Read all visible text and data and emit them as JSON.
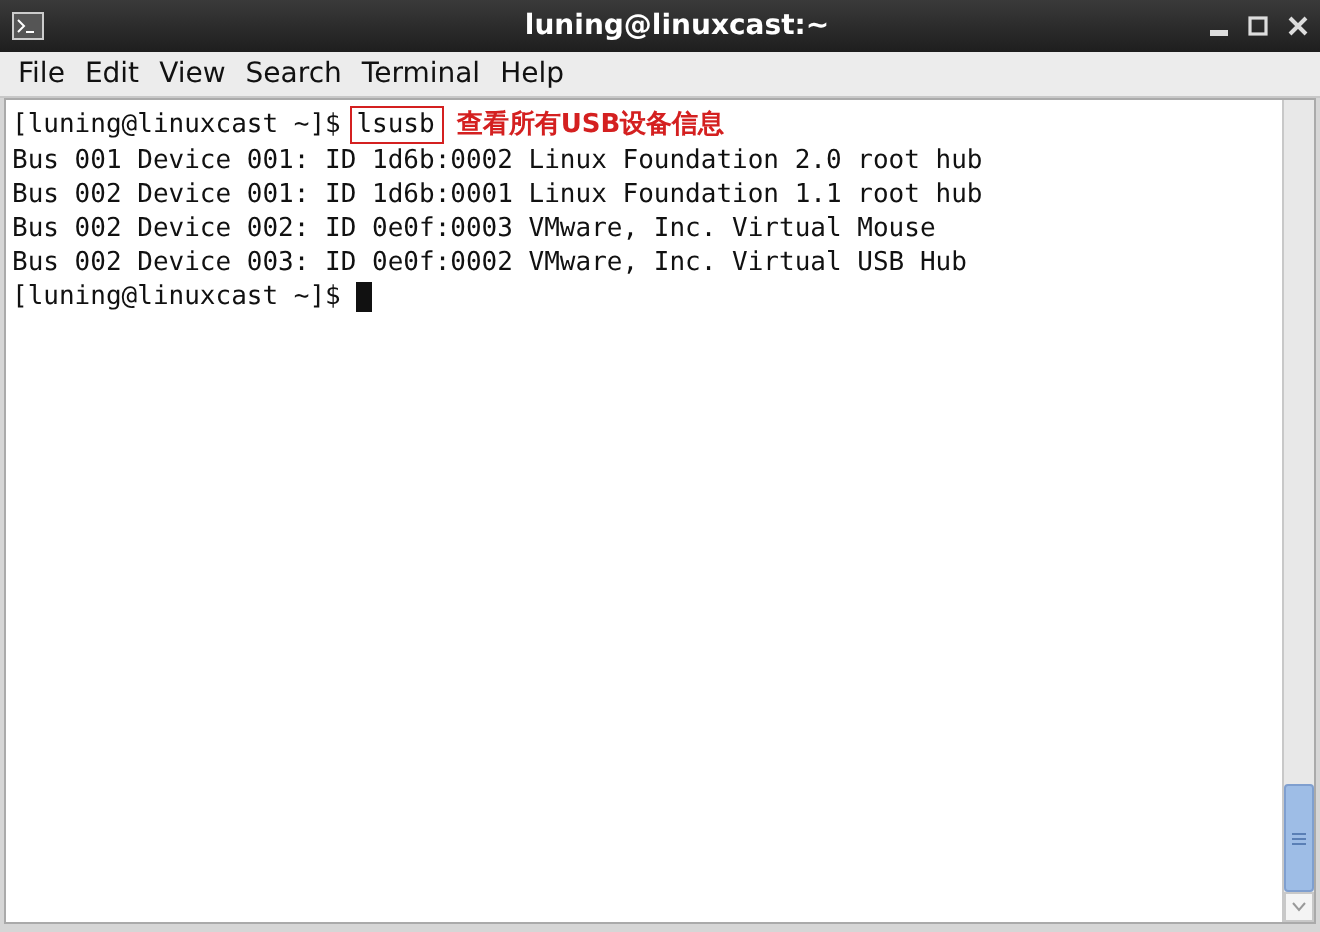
{
  "window": {
    "title": "luning@linuxcast:~"
  },
  "menu": [
    "File",
    "Edit",
    "View",
    "Search",
    "Terminal",
    "Help"
  ],
  "terminal": {
    "lines": [
      {
        "kind": "command",
        "prompt": "[luning@linuxcast ~]$ ",
        "command": "lsusb",
        "annotation": "查看所有USB设备信息"
      },
      {
        "kind": "output",
        "text": "Bus 001 Device 001: ID 1d6b:0002 Linux Foundation 2.0 root hub"
      },
      {
        "kind": "output",
        "text": "Bus 002 Device 001: ID 1d6b:0001 Linux Foundation 1.1 root hub"
      },
      {
        "kind": "output",
        "text": "Bus 002 Device 002: ID 0e0f:0003 VMware, Inc. Virtual Mouse"
      },
      {
        "kind": "output",
        "text": "Bus 002 Device 003: ID 0e0f:0002 VMware, Inc. Virtual USB Hub"
      },
      {
        "kind": "prompt",
        "prompt": "[luning@linuxcast ~]$ "
      }
    ]
  }
}
